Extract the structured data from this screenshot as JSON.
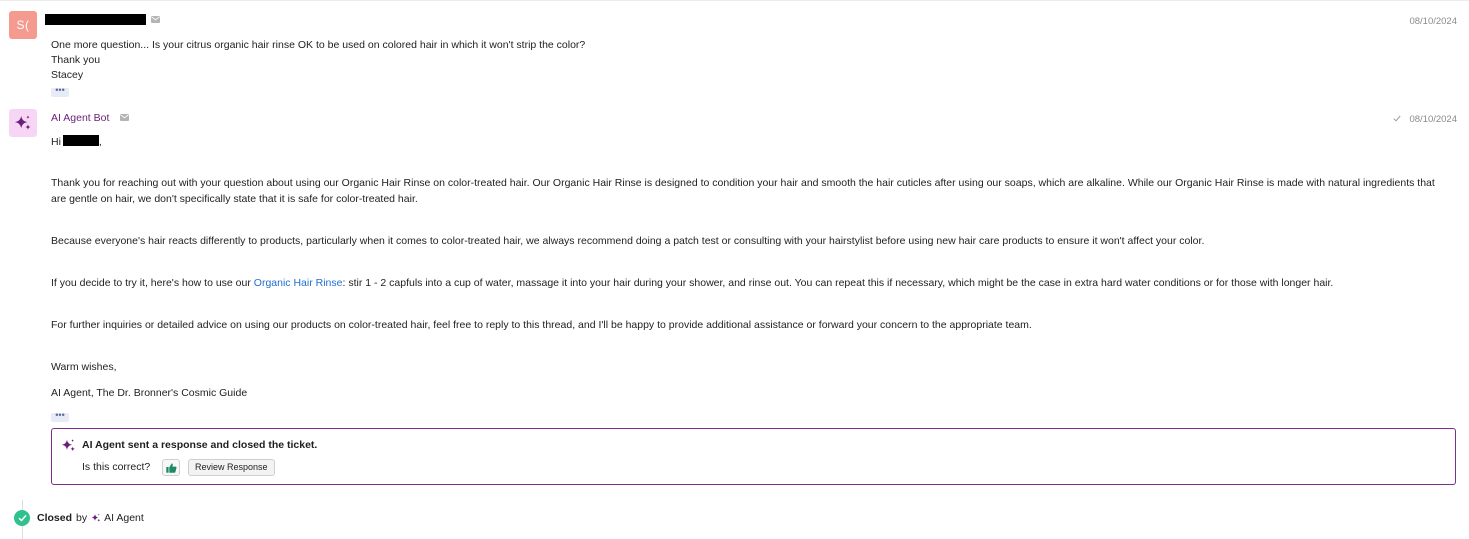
{
  "messages": [
    {
      "avatar_initials": "S(",
      "date": "08/10/2024",
      "lines": [
        "One more question... Is your citrus organic hair rinse OK to be used on colored hair in which it won't strip the color?",
        "Thank you",
        "Stacey"
      ],
      "more_label": "•••"
    },
    {
      "sender": "AI Agent Bot",
      "date": "08/10/2024",
      "status_icon": "check-icon",
      "greeting": "Hi",
      "greeting_suffix": ",",
      "paragraphs": [
        "Thank you for reaching out with your question about using our Organic Hair Rinse on color-treated hair. Our Organic Hair Rinse is designed to condition your hair and smooth the hair cuticles after using our soaps, which are alkaline. While our Organic Hair Rinse is made with natural ingredients that are gentle on hair, we don't specifically state that it is safe for color-treated hair.",
        "Because everyone's hair reacts differently to products, particularly when it comes to color-treated hair, we always recommend doing a patch test or consulting with your hairstylist before using new hair care products to ensure it won't affect your color."
      ],
      "how_to": {
        "before": "If you decide to try it, here's how to use our ",
        "link": "Organic Hair Rinse",
        "after": ": stir 1 - 2 capfuls into a cup of water, massage it into your hair during your shower, and rinse out. You can repeat this if necessary, which might be the case in extra hard water conditions or for those with longer hair."
      },
      "further": "For further inquiries or detailed advice on using our products on color-treated hair, feel free to reply to this thread, and I'll be happy to provide additional assistance or forward your concern to the appropriate team.",
      "signoff": "Warm wishes,",
      "signature": "AI Agent, The Dr. Bronner's Cosmic Guide",
      "more_label": "•••"
    }
  ],
  "notice": {
    "title": "AI Agent sent a response and closed the ticket.",
    "question": "Is this correct?",
    "review_label": "Review Response"
  },
  "status": {
    "closed_label": "Closed",
    "by_label": "by",
    "agent_label": "AI Agent"
  },
  "colors": {
    "accent_purple": "#7c2d8e",
    "closed_green": "#2fc28c",
    "link_blue": "#1f6fcf",
    "avatar_customer": "#f49a8e",
    "avatar_bot": "#f7d6f5"
  }
}
